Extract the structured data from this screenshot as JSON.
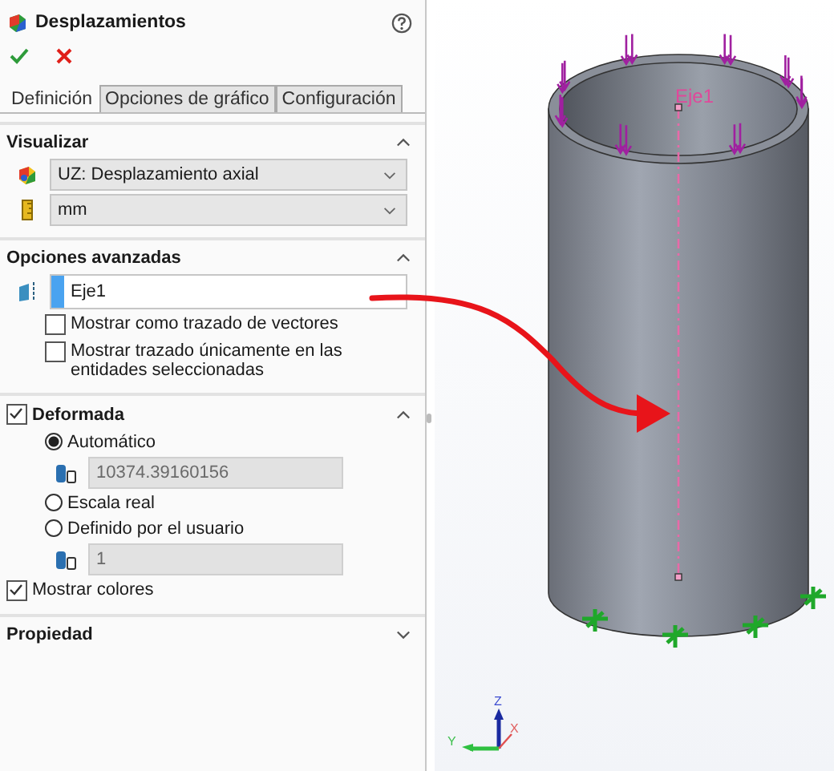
{
  "window": {
    "title": "Desplazamientos"
  },
  "tabs": [
    {
      "label": "Definición",
      "selected": true
    },
    {
      "label": "Opciones de gráfico",
      "selected": false
    },
    {
      "label": "Configuración",
      "selected": false
    }
  ],
  "visualizar": {
    "label": "Visualizar",
    "expanded": true,
    "dropdowns": [
      {
        "value": "UZ: Desplazamiento axial"
      },
      {
        "value": "mm"
      }
    ]
  },
  "opciones_avanzadas": {
    "label": "Opciones avanzadas",
    "expanded": true,
    "field": {
      "value": "Eje1"
    },
    "checkboxes": [
      {
        "label": "Mostrar como trazado de vectores",
        "checked": false
      },
      {
        "label": "Mostrar trazado únicamente en las entidades seleccionadas",
        "checked": false
      }
    ]
  },
  "deformada": {
    "label": "Deformada",
    "checked": true,
    "expanded": true,
    "options": [
      {
        "kind": "radio",
        "label": "Automático",
        "selected": true
      },
      {
        "kind": "field",
        "value": "10374.39160156",
        "disabled": true
      },
      {
        "kind": "radio",
        "label": "Escala real",
        "selected": false
      },
      {
        "kind": "radio",
        "label": "Definido por el usuario",
        "selected": false
      },
      {
        "kind": "field",
        "value": "1",
        "disabled": true
      }
    ],
    "show_colors": {
      "label": "Mostrar colores",
      "checked": true
    }
  },
  "propiedad": {
    "label": "Propiedad",
    "expanded": false
  },
  "viewport": {
    "axis_label": "Eje1",
    "triad": {
      "z": "Z",
      "x": "X",
      "y": "Y"
    }
  }
}
